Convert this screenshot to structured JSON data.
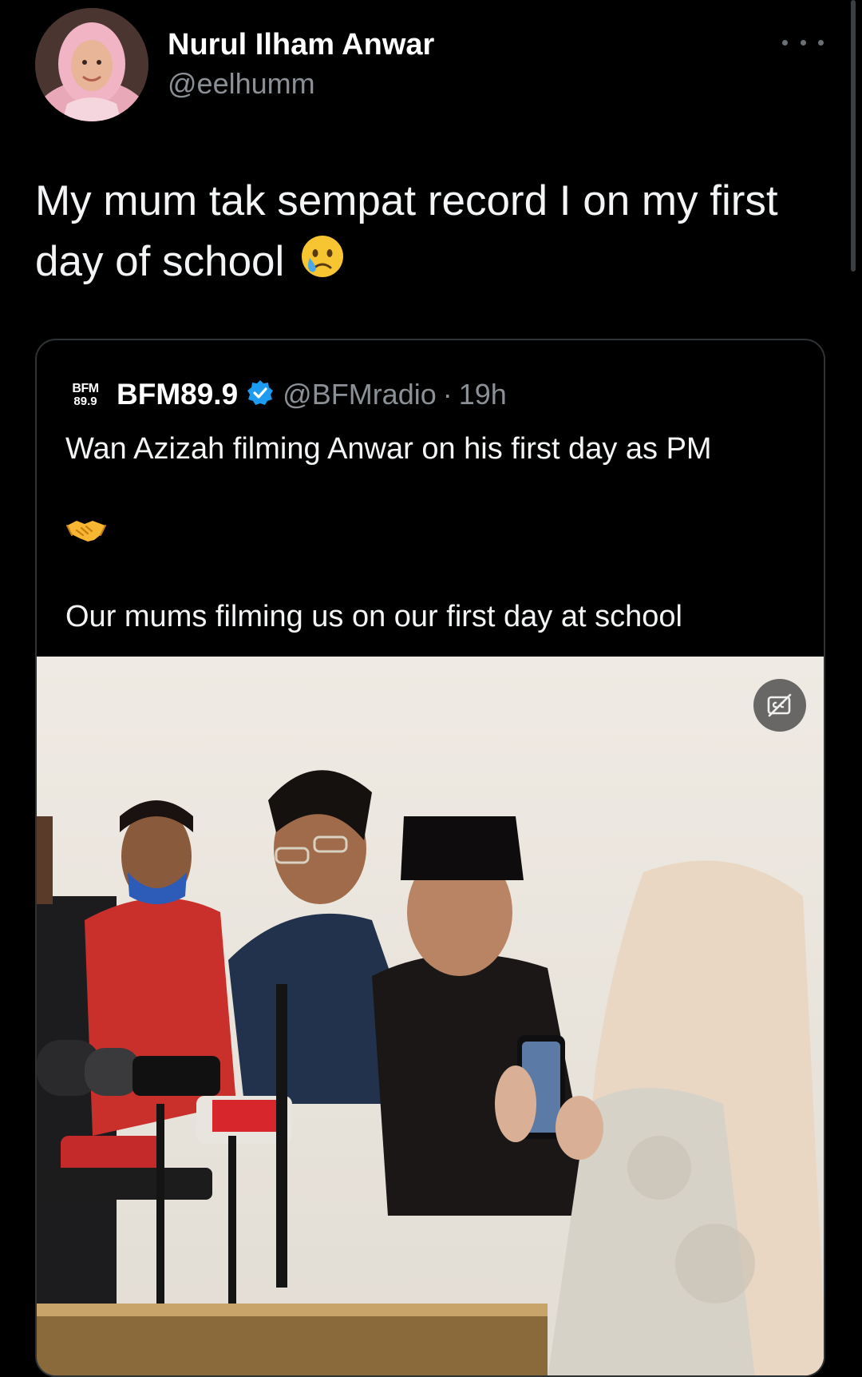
{
  "author": {
    "display_name": "Nurul Ilham Anwar",
    "handle": "@eelhumm"
  },
  "tweet": {
    "text": "My mum tak sempat record I on my first day of school",
    "emoji": "crying-face"
  },
  "quote": {
    "logo_top": "BFM",
    "logo_bottom": "89.9",
    "display_name": "BFM89.9",
    "handle": "@BFMradio",
    "separator": "·",
    "time": "19h",
    "line1": "Wan Azizah filming Anwar on his first day as PM",
    "emoji": "handshake",
    "line2": "Our mums filming us on our first day at school"
  },
  "icons": {
    "more": "more-horizontal-icon",
    "verified": "verified-badge-icon",
    "captions": "captions-off-icon"
  },
  "colors": {
    "background": "#000000",
    "text": "#e7e9ea",
    "secondary": "#8b9096",
    "border": "#2f3336",
    "verified": "#1d9bf0"
  }
}
